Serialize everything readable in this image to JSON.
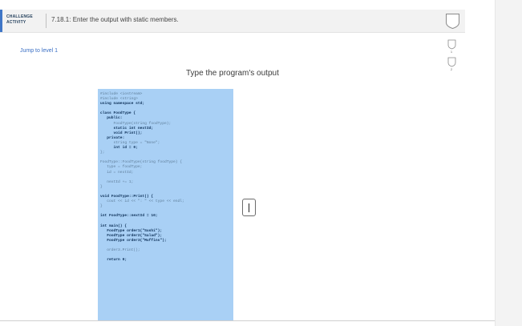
{
  "activity": {
    "label_line1": "CHALLENGE",
    "label_line2": "ACTIVITY",
    "title": "7.18.1: Enter the output with static members."
  },
  "jump_link": "Jump to level 1",
  "levels": [
    "1",
    "2"
  ],
  "prompt": "Type the program's output",
  "code": {
    "lines": [
      {
        "text": "#include <iostream>",
        "kw": false
      },
      {
        "text": "#include <string>",
        "kw": false
      },
      {
        "text": "using namespace std;",
        "kw": true
      },
      {
        "text": "",
        "kw": false
      },
      {
        "text": "class FoodType {",
        "kw": true
      },
      {
        "text": "   public:",
        "kw": true
      },
      {
        "text": "      FoodType(string foodType);",
        "kw": false
      },
      {
        "text": "      static int nextId;",
        "kw": true
      },
      {
        "text": "      void Print();",
        "kw": true
      },
      {
        "text": "   private:",
        "kw": true
      },
      {
        "text": "      string type = \"None\";",
        "kw": false
      },
      {
        "text": "      int id = 0;",
        "kw": true
      },
      {
        "text": "};",
        "kw": false
      },
      {
        "text": "",
        "kw": false
      },
      {
        "text": "FoodType::FoodType(string foodType) {",
        "kw": false
      },
      {
        "text": "   type = foodType;",
        "kw": false
      },
      {
        "text": "   id = nextId;",
        "kw": false
      },
      {
        "text": "",
        "kw": false
      },
      {
        "text": "   nextId += 1;",
        "kw": false
      },
      {
        "text": "}",
        "kw": false
      },
      {
        "text": "",
        "kw": false
      },
      {
        "text": "void FoodType::Print() {",
        "kw": true
      },
      {
        "text": "   cout << id << \": \" << type << endl;",
        "kw": false
      },
      {
        "text": "}",
        "kw": false
      },
      {
        "text": "",
        "kw": false
      },
      {
        "text": "int FoodType::nextId = 10;",
        "kw": true
      },
      {
        "text": "",
        "kw": false
      },
      {
        "text": "int main() {",
        "kw": true
      },
      {
        "text": "   FoodType order1(\"Sushi\");",
        "kw": true
      },
      {
        "text": "   FoodType order2(\"Salad\");",
        "kw": true
      },
      {
        "text": "   FoodType order3(\"Muffins\");",
        "kw": true
      },
      {
        "text": "",
        "kw": false
      },
      {
        "text": "   order3.Print();",
        "kw": false
      },
      {
        "text": "",
        "kw": false
      },
      {
        "text": "   return 0;",
        "kw": true
      }
    ]
  },
  "answer": {
    "value": ""
  },
  "colors": {
    "accent": "#3f76c7",
    "code_background": "#a9d0f5",
    "link": "#3a6fc4"
  }
}
